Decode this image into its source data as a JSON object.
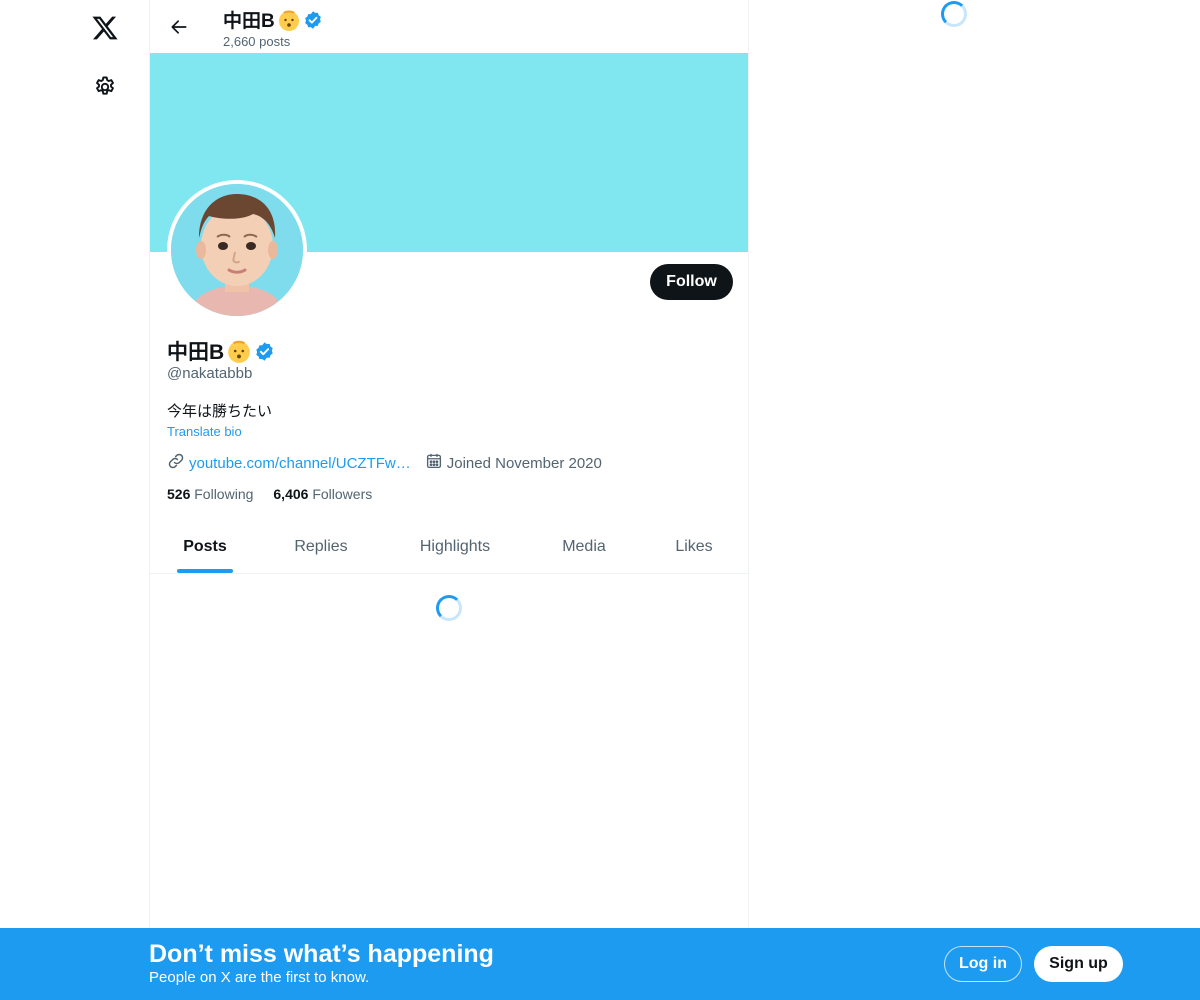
{
  "nav": {
    "logo_icon": "x-logo-icon",
    "settings_icon": "gear-icon"
  },
  "header": {
    "name": "中田B",
    "posts_count": "2,660 posts"
  },
  "profile": {
    "name": "中田B",
    "handle": "@nakatabbb",
    "bio": "今年は勝ちたい",
    "translate_label": "Translate bio",
    "website": "youtube.com/channel/UCZTFw…",
    "joined": "Joined November 2020",
    "following_count": "526",
    "following_label": "Following",
    "followers_count": "6,406",
    "followers_label": "Followers",
    "follow_button": "Follow",
    "banner_color": "#80e6f0",
    "verified_color": "#1d9bf0"
  },
  "tabs": [
    {
      "label": "Posts",
      "active": true
    },
    {
      "label": "Replies",
      "active": false
    },
    {
      "label": "Highlights",
      "active": false
    },
    {
      "label": "Media",
      "active": false
    },
    {
      "label": "Likes",
      "active": false
    }
  ],
  "bottom_bar": {
    "title": "Don’t miss what’s happening",
    "subtitle": "People on X are the first to know.",
    "login_label": "Log in",
    "signup_label": "Sign up",
    "background_color": "#1d9bf0"
  }
}
